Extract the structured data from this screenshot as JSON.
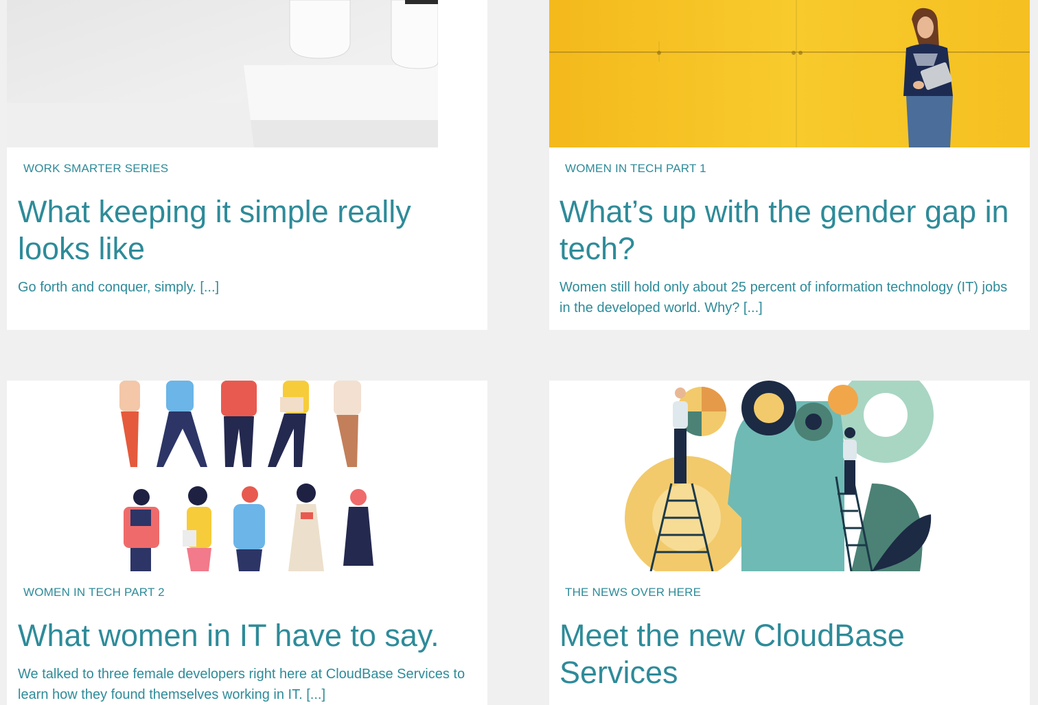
{
  "cards": [
    {
      "category": "WORK SMARTER SERIES",
      "title": "What keeping it simple really looks like",
      "excerpt": "Go forth and conquer, simply. [...]",
      "image": "minimal-desk-cups-photo"
    },
    {
      "category": "WOMEN IN TECH PART 1",
      "title": "What’s up with the gender gap in tech?",
      "excerpt": "Women still hold only about 25 percent of information technology (IT) jobs in the developed world. Why? [...]",
      "image": "woman-with-tablet-yellow-wall-photo"
    },
    {
      "category": "WOMEN IN TECH PART 2",
      "title": "What women in IT have to say.",
      "excerpt": "We talked to three female developers right here at CloudBase Services to learn how they found themselves working in IT. [...]",
      "image": "diverse-people-illustration"
    },
    {
      "category": "THE NEWS OVER HERE",
      "title": "Meet the new CloudBase Services",
      "excerpt": "",
      "image": "head-gears-ladders-illustration"
    }
  ],
  "colors": {
    "accent": "#2e8b99",
    "page_background": "#f0f0f0",
    "card_background": "#ffffff",
    "yellow_wall": "#f7c624"
  }
}
